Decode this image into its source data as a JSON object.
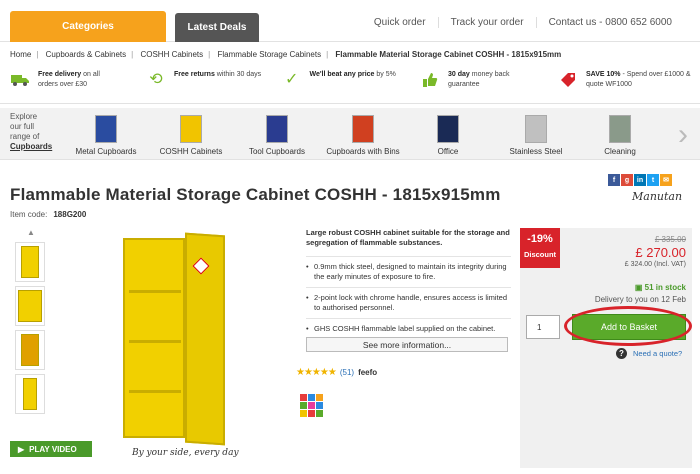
{
  "nav": {
    "categories_label": "Categories",
    "deals_label": "Latest Deals",
    "links": [
      "Quick order",
      "Track your order",
      "Contact us - 0800 652 6000"
    ]
  },
  "breadcrumb": [
    "Home",
    "Cupboards & Cabinets",
    "COSHH Cabinets",
    "Flammable Storage Cabinets",
    "Flammable Material Storage Cabinet COSHH - 1815x915mm"
  ],
  "usp": [
    {
      "icon": "truck-icon",
      "bold": "Free delivery",
      "text": " on all orders over £30"
    },
    {
      "icon": "return-icon",
      "bold": "Free returns",
      "text": " within 30 days"
    },
    {
      "icon": "check-icon",
      "bold": "We'll beat any price",
      "text": " by 5%"
    },
    {
      "icon": "thumbs-up-icon",
      "bold": "30 day",
      "text": " money back guarantee"
    },
    {
      "icon": "tag-icon",
      "bold": "SAVE 10%",
      "text": " - Spend over £1000 & quote WF1000"
    }
  ],
  "explore": {
    "line1": "Explore",
    "line2": "our full",
    "line3": "range of",
    "link": "Cupboards"
  },
  "categories": [
    {
      "label": "Metal Cupboards",
      "color": "#2a4ca0"
    },
    {
      "label": "COSHH Cabinets",
      "color": "#f1c400"
    },
    {
      "label": "Tool Cupboards",
      "color": "#2a3c90"
    },
    {
      "label": "Cupboards with Bins",
      "color": "#d04020"
    },
    {
      "label": "Office",
      "color": "#1a2a55"
    },
    {
      "label": "Stainless Steel",
      "color": "#c0c0c0"
    },
    {
      "label": "Cleaning",
      "color": "#8a9a8a"
    }
  ],
  "product": {
    "title": "Flammable Material Storage Cabinet COSHH - 1815x915mm",
    "item_code_label": "Item code:",
    "item_code": "188G200",
    "brand": "Manutan",
    "tagline": "By your side, every day",
    "play_video": "PLAY VIDEO",
    "lead": "Large robust COSHH cabinet suitable for the storage and segregation of flammable substances.",
    "bullets": [
      "0.9mm thick steel, designed to maintain its integrity during the early minutes of exposure to fire.",
      "2-point lock with chrome handle, ensures access is limited to authorised personnel.",
      "GHS COSHH flammable label supplied on the cabinet."
    ],
    "more_info": "See more information...",
    "review_count": "(51)",
    "feefo": "feefo"
  },
  "price": {
    "discount_pct": "-19%",
    "discount_label": "Discount",
    "was": "£ 335.00",
    "now": "£ 270.00",
    "inc_vat": "£ 324.00 (Incl. VAT)",
    "stock": "51 in stock",
    "delivery": "Delivery to you on 12 Feb",
    "qty": "1",
    "basket": "Add to Basket",
    "quote": "Need a quote?"
  },
  "colors": {
    "accent": "#f6a21c",
    "green": "#5aaa2a",
    "red": "#d8232a"
  }
}
